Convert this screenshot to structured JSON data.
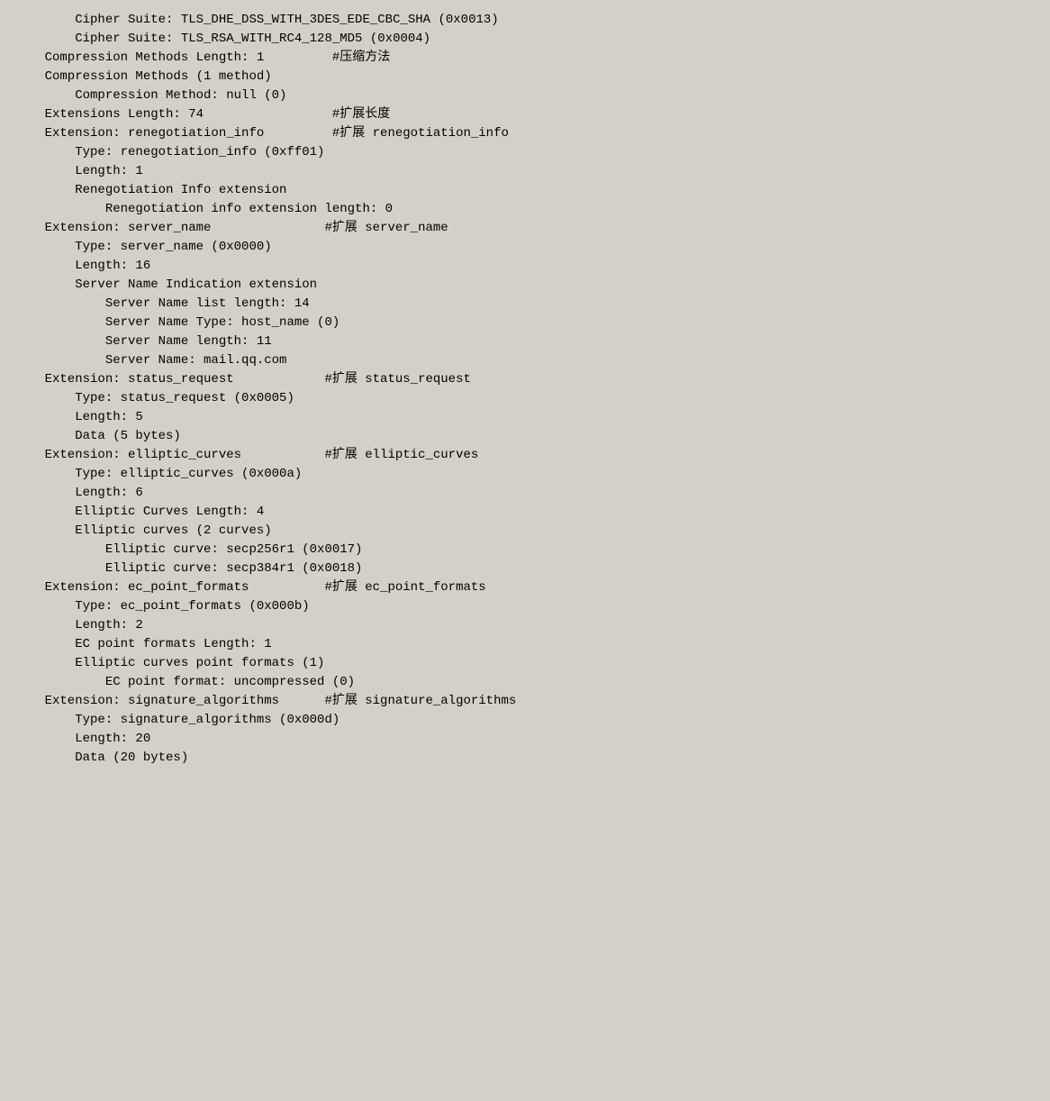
{
  "lines": [
    {
      "text": "        Cipher Suite: TLS_DHE_DSS_WITH_3DES_EDE_CBC_SHA (0x0013)",
      "indent": 0
    },
    {
      "text": "        Cipher Suite: TLS_RSA_WITH_RC4_128_MD5 (0x0004)",
      "indent": 0
    },
    {
      "text": "    Compression Methods Length: 1         #压缩方法",
      "indent": 0
    },
    {
      "text": "    Compression Methods (1 method)",
      "indent": 0
    },
    {
      "text": "        Compression Method: null (0)",
      "indent": 0
    },
    {
      "text": "    Extensions Length: 74                 #扩展长度",
      "indent": 0
    },
    {
      "text": "    Extension: renegotiation_info         #扩展 renegotiation_info",
      "indent": 0
    },
    {
      "text": "        Type: renegotiation_info (0xff01)",
      "indent": 0
    },
    {
      "text": "        Length: 1",
      "indent": 0
    },
    {
      "text": "        Renegotiation Info extension",
      "indent": 0
    },
    {
      "text": "            Renegotiation info extension length: 0",
      "indent": 0
    },
    {
      "text": "    Extension: server_name               #扩展 server_name",
      "indent": 0
    },
    {
      "text": "        Type: server_name (0x0000)",
      "indent": 0
    },
    {
      "text": "        Length: 16",
      "indent": 0
    },
    {
      "text": "        Server Name Indication extension",
      "indent": 0
    },
    {
      "text": "            Server Name list length: 14",
      "indent": 0
    },
    {
      "text": "            Server Name Type: host_name (0)",
      "indent": 0
    },
    {
      "text": "            Server Name length: 11",
      "indent": 0
    },
    {
      "text": "            Server Name: mail.qq.com",
      "indent": 0
    },
    {
      "text": "    Extension: status_request            #扩展 status_request",
      "indent": 0
    },
    {
      "text": "        Type: status_request (0x0005)",
      "indent": 0
    },
    {
      "text": "        Length: 5",
      "indent": 0
    },
    {
      "text": "        Data (5 bytes)",
      "indent": 0
    },
    {
      "text": "    Extension: elliptic_curves           #扩展 elliptic_curves",
      "indent": 0
    },
    {
      "text": "        Type: elliptic_curves (0x000a)",
      "indent": 0
    },
    {
      "text": "        Length: 6",
      "indent": 0
    },
    {
      "text": "        Elliptic Curves Length: 4",
      "indent": 0
    },
    {
      "text": "        Elliptic curves (2 curves)",
      "indent": 0
    },
    {
      "text": "            Elliptic curve: secp256r1 (0x0017)",
      "indent": 0
    },
    {
      "text": "            Elliptic curve: secp384r1 (0x0018)",
      "indent": 0
    },
    {
      "text": "    Extension: ec_point_formats          #扩展 ec_point_formats",
      "indent": 0
    },
    {
      "text": "        Type: ec_point_formats (0x000b)",
      "indent": 0
    },
    {
      "text": "        Length: 2",
      "indent": 0
    },
    {
      "text": "        EC point formats Length: 1",
      "indent": 0
    },
    {
      "text": "        Elliptic curves point formats (1)",
      "indent": 0
    },
    {
      "text": "            EC point format: uncompressed (0)",
      "indent": 0
    },
    {
      "text": "    Extension: signature_algorithms      #扩展 signature_algorithms",
      "indent": 0
    },
    {
      "text": "        Type: signature_algorithms (0x000d)",
      "indent": 0
    },
    {
      "text": "        Length: 20",
      "indent": 0
    },
    {
      "text": "        Data (20 bytes)",
      "indent": 0
    }
  ]
}
